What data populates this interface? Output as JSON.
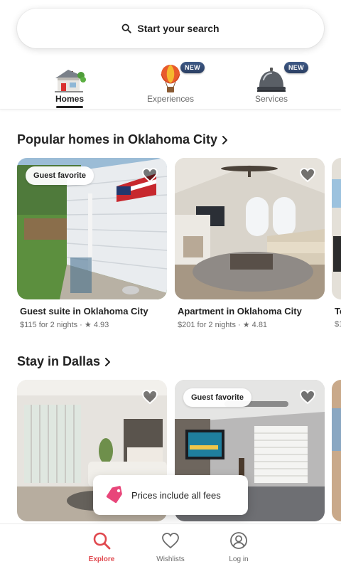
{
  "search": {
    "label": "Start your search",
    "icon": "search-icon"
  },
  "categories": [
    {
      "label": "Homes",
      "icon": "house-icon",
      "active": true
    },
    {
      "label": "Experiences",
      "icon": "hot-air-balloon-icon",
      "badge": "NEW"
    },
    {
      "label": "Services",
      "icon": "service-bell-icon",
      "badge": "NEW"
    }
  ],
  "sections": [
    {
      "title": "Popular homes in Oklahoma City",
      "listings": [
        {
          "badge": "Guest favorite",
          "title": "Guest suite in Oklahoma City",
          "meta": "$115 for 2 nights · ★ 4.93"
        },
        {
          "title": "Apartment in Oklahoma City",
          "meta": "$201 for 2 nights · ★ 4.81"
        },
        {
          "title": "To",
          "meta": "$1"
        }
      ]
    },
    {
      "title": "Stay in Dallas",
      "listings": [
        {
          "title": ""
        },
        {
          "badge": "Guest favorite",
          "title": ""
        },
        {
          "title": ""
        }
      ]
    }
  ],
  "toast": {
    "label": "Prices include all fees",
    "icon": "price-tag-icon"
  },
  "bottom_nav": [
    {
      "label": "Explore",
      "icon": "search-icon",
      "active": true
    },
    {
      "label": "Wishlists",
      "icon": "heart-icon"
    },
    {
      "label": "Log in",
      "icon": "profile-icon"
    }
  ],
  "colors": {
    "accent": "#e0484e",
    "text": "#222222",
    "muted": "#6a6a6a",
    "badge": "#2b3f63"
  }
}
